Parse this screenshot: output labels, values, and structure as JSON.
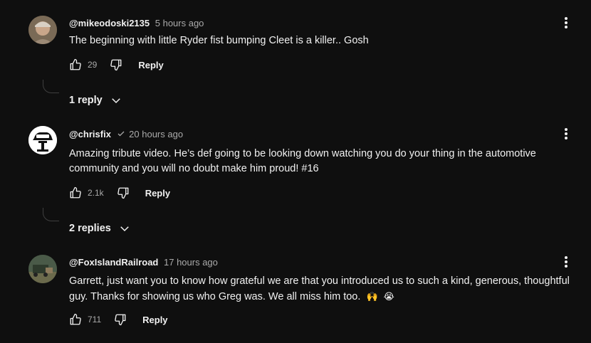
{
  "comments": [
    {
      "handle": "@mikeodoski2135",
      "time": "5 hours ago",
      "verified": false,
      "text": "The beginning with little Ryder fist bumping Cleet is a killer.. Gosh",
      "likes": "29",
      "reply_label": "Reply",
      "replies_label": "1 reply"
    },
    {
      "handle": "@chrisfix",
      "time": "20 hours ago",
      "verified": true,
      "text": "Amazing tribute video. He’s def going to be looking down watching you do your thing in the automotive community and you will no doubt make him proud! #16",
      "likes": "2.1k",
      "reply_label": "Reply",
      "replies_label": "2 replies"
    },
    {
      "handle": "@FoxIslandRailroad",
      "time": "17 hours ago",
      "verified": false,
      "text": "Garrett, just want you to know how grateful we are that you introduced us to such a kind, generous, thoughtful guy. Thanks for showing us who Greg was. We all miss him too.",
      "emojis": [
        "🙌",
        "😭"
      ],
      "likes": "711",
      "reply_label": "Reply"
    }
  ],
  "icons": {
    "like": "thumbs-up-icon",
    "dislike": "thumbs-down-icon",
    "menu": "more-vert-icon",
    "expand": "chevron-down-icon",
    "verified": "checkmark-icon"
  },
  "colors": {
    "background": "#0f0f0f",
    "text": "#f1f1f1",
    "secondary": "#aaaaaa"
  }
}
